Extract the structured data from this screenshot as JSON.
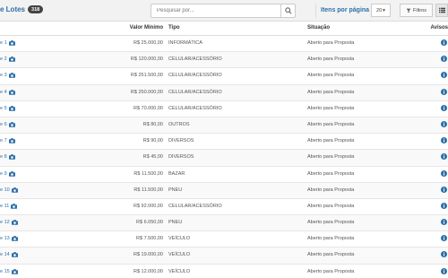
{
  "header": {
    "title": "e Lotes",
    "count": "318",
    "search_placeholder": "Pesquisar por...",
    "per_page_label": "Itens por página",
    "per_page_value": "20",
    "filter_label": "Filtros"
  },
  "table": {
    "columns": {
      "valor": "Valor Mínimo",
      "tipo": "Tipo",
      "situacao": "Situação",
      "avisos": "Avisos"
    },
    "rows": [
      {
        "lote": "e 1",
        "valor": "R$ 25.000,00",
        "tipo": "INFORMÁTICA",
        "situacao": "Aberto para Proposta"
      },
      {
        "lote": "e 2",
        "valor": "R$ 120.000,00",
        "tipo": "CELULAR/ACESSÓRIO",
        "situacao": "Aberto para Proposta"
      },
      {
        "lote": "e 3",
        "valor": "R$ 251.500,00",
        "tipo": "CELULAR/ACESSÓRIO",
        "situacao": "Aberto para Proposta"
      },
      {
        "lote": "e 4",
        "valor": "R$ 250.000,00",
        "tipo": "CELULAR/ACESSÓRIO",
        "situacao": "Aberto para Proposta"
      },
      {
        "lote": "e 5",
        "valor": "R$ 70.000,00",
        "tipo": "CELULAR/ACESSÓRIO",
        "situacao": "Aberto para Proposta"
      },
      {
        "lote": "e 6",
        "valor": "R$ 80,00",
        "tipo": "OUTROS",
        "situacao": "Aberto para Proposta"
      },
      {
        "lote": "e 7",
        "valor": "R$ 90,00",
        "tipo": "DIVERSOS",
        "situacao": "Aberto para Proposta"
      },
      {
        "lote": "e 8",
        "valor": "R$ 45,00",
        "tipo": "DIVERSOS",
        "situacao": "Aberto para Proposta"
      },
      {
        "lote": "e 9",
        "valor": "R$ 11.500,00",
        "tipo": "BAZAR",
        "situacao": "Aberto para Proposta"
      },
      {
        "lote": "e 10",
        "valor": "R$ 11.500,00",
        "tipo": "PNEU",
        "situacao": "Aberto para Proposta"
      },
      {
        "lote": "e 11",
        "valor": "R$ 92.000,00",
        "tipo": "CELULAR/ACESSÓRIO",
        "situacao": "Aberto para Proposta"
      },
      {
        "lote": "e 12",
        "valor": "R$ 6.050,00",
        "tipo": "PNEU",
        "situacao": "Aberto para Proposta"
      },
      {
        "lote": "e 13",
        "valor": "R$ 7.500,00",
        "tipo": "VEÍCULO",
        "situacao": "Aberto para Proposta"
      },
      {
        "lote": "e 14",
        "valor": "R$ 19.000,00",
        "tipo": "VEÍCULO",
        "situacao": "Aberto para Proposta"
      },
      {
        "lote": "e 15",
        "valor": "R$ 12.000,00",
        "tipo": "VEÍCULO",
        "situacao": "Aberto para Proposta"
      }
    ]
  },
  "colors": {
    "link": "#2d6fa8",
    "badge": "#444444",
    "info_icon": "#2d6fa8"
  },
  "icons": {
    "search": "search-icon",
    "camera": "camera-icon",
    "info": "info-icon",
    "filter": "filter-icon",
    "list": "list-icon"
  }
}
